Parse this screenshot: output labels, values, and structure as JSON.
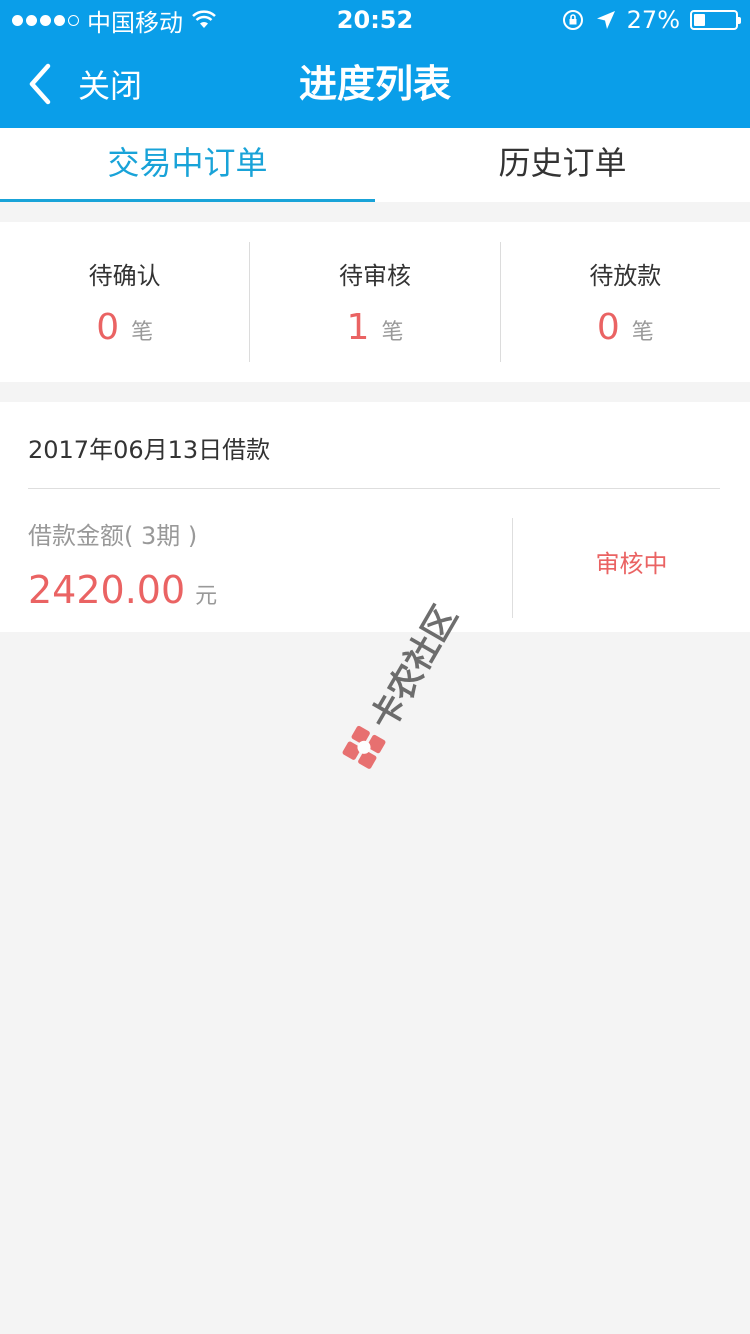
{
  "status_bar": {
    "carrier": "中国移动",
    "time": "20:52",
    "battery_text": "27%",
    "battery_level": 0.27
  },
  "nav": {
    "back_label": "关闭",
    "title": "进度列表"
  },
  "tabs": [
    {
      "label": "交易中订单",
      "active": true
    },
    {
      "label": "历史订单",
      "active": false
    }
  ],
  "stats": [
    {
      "label": "待确认",
      "count": "0",
      "unit": "笔"
    },
    {
      "label": "待审核",
      "count": "1",
      "unit": "笔"
    },
    {
      "label": "待放款",
      "count": "0",
      "unit": "笔"
    }
  ],
  "order": {
    "date_title": "2017年06月13日借款",
    "amount_label": "借款金额( 3期 )",
    "amount": "2420.00",
    "amount_unit": "元",
    "status": "审核中"
  },
  "watermark": {
    "text": "卡农社区"
  },
  "colors": {
    "brand_blue": "#0a9ee9",
    "tab_active": "#19a3d8",
    "accent_red": "#ea6363"
  }
}
